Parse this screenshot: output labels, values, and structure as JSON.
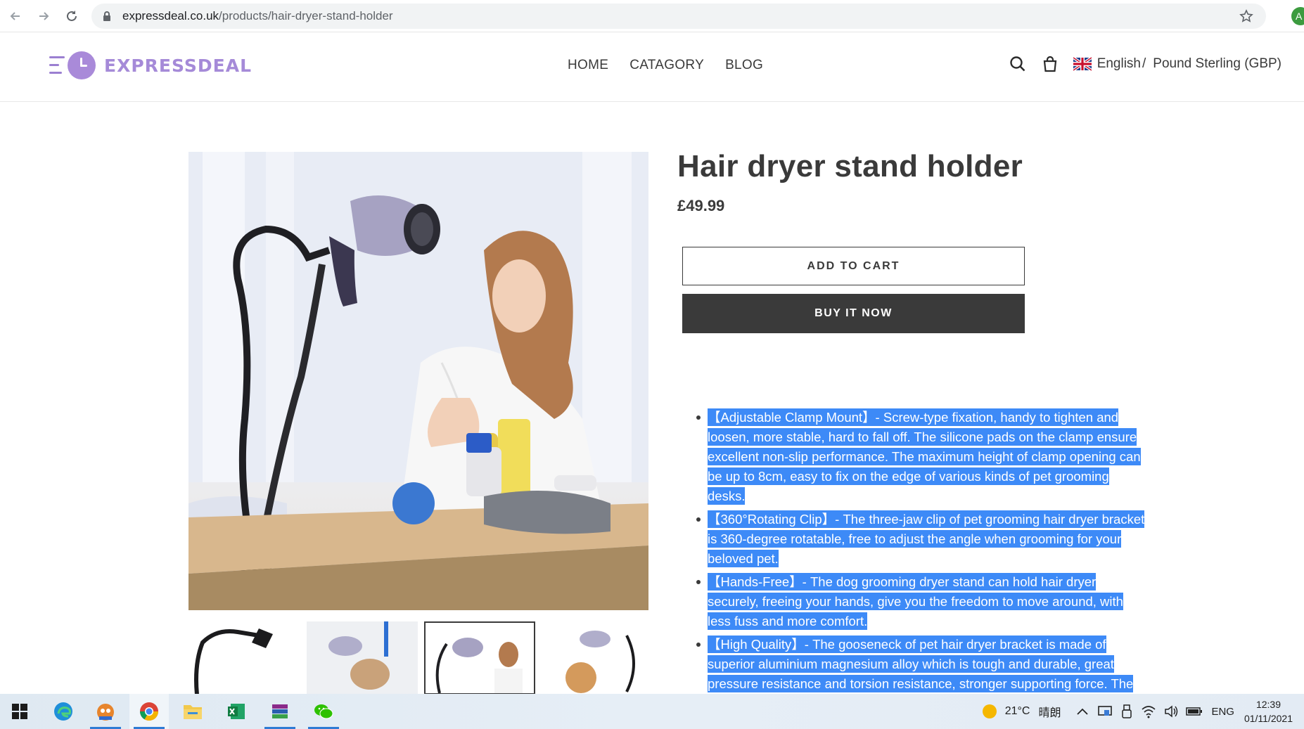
{
  "browser": {
    "url_domain": "expressdeal.co.uk",
    "url_path": "/products/hair-dryer-stand-holder",
    "profile_initial": "A"
  },
  "header": {
    "logo_text": "EXPRESSDEAL",
    "nav": [
      "HOME",
      "CATAGORY",
      "BLOG"
    ],
    "language": "English",
    "separator": "/",
    "currency": "Pound Sterling (GBP)"
  },
  "product": {
    "title": "Hair dryer stand holder",
    "price": "£49.99",
    "add_to_cart": "ADD TO CART",
    "buy_now": "BUY IT NOW",
    "bullets": [
      "【Adjustable Clamp Mount】- Screw-type fixation, handy to tighten and loosen, more stable, hard to fall off. The silicone pads on the clamp ensure excellent non-slip performance. The maximum height of clamp opening can be up to 8cm, easy to fix on the edge of various kinds of pet grooming desks.",
      "【360°Rotating Clip】- The three-jaw clip of pet grooming hair dryer bracket is 360-degree rotatable, free to adjust the angle when grooming for your beloved pet.",
      "【Hands-Free】- The dog grooming dryer stand can hold hair dryer securely, freeing your hands, give you the freedom to move around, with less fuss and more comfort.",
      "【High Quality】- The gooseneck of pet hair dryer bracket is made of superior aluminium magnesium alloy which is tough and durable, great pressure resistance and torsion resistance, stronger supporting force. The"
    ]
  },
  "taskbar": {
    "weather_temp": "21°C",
    "weather_text": "晴朗",
    "input_lang": "ENG",
    "time": "12:39",
    "date": "01/11/2021"
  },
  "colors": {
    "accent_purple": "#a58ad8",
    "dark": "#3a3a3a",
    "selection": "#3d8af7"
  }
}
